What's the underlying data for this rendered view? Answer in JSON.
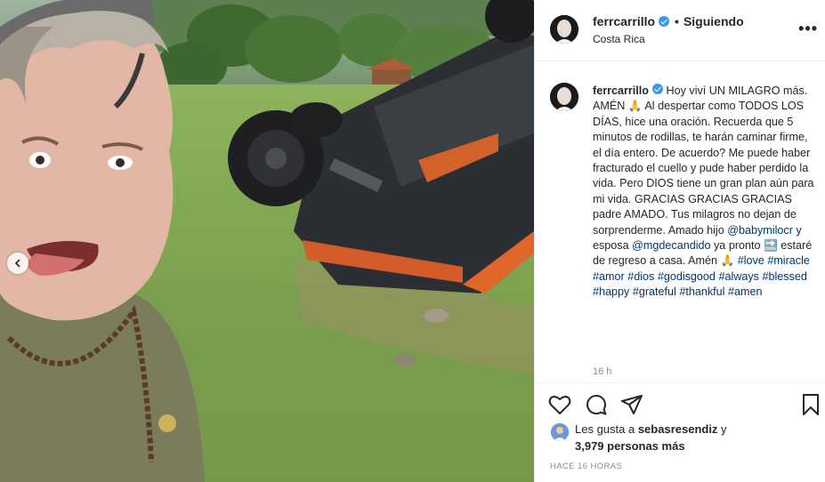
{
  "post": {
    "username": "ferrcarrillo",
    "follow_status": "Siguiendo",
    "location": "Costa Rica",
    "more_icon": "more-icon"
  },
  "caption": {
    "username": "ferrcarrillo",
    "part1": "Hoy viví UN MILAGRO más. AMÉN 🙏 Al despertar como TODOS LOS DÍAS, hice una oración. Recuerda que 5 minutos de rodillas, te harán caminar firme, el día entero. De acuerdo? Me puede haber fracturado el cuello y pude haber perdido la vida. Pero DIOS tiene un gran plan aún para mi vida. GRACIAS GRACIAS GRACIAS padre AMADO. Tus milagros no dejan de sorprenderme. Amado hijo ",
    "mention1": "@babymilocr",
    "part2": " y esposa ",
    "mention2": "@mgdecandido",
    "part3": " ya pronto 🔜 estaré de regreso a casa. Amén 🙏 ",
    "hashtags": [
      "#love",
      "#miracle",
      "#amor",
      "#dios",
      "#godisgood",
      "#always",
      "#blessed",
      "#happy",
      "#grateful",
      "#thankful",
      "#amen"
    ],
    "time": "16 h"
  },
  "likes": {
    "prefix": "Les gusta a ",
    "user": "sebasresendiz",
    "connector": " y",
    "count": "3,979 personas más"
  },
  "timestamp": "HACE 16 HORAS",
  "colors": {
    "link": "#00376b",
    "verified": "#3897f0",
    "muted": "#8e8e8e"
  }
}
